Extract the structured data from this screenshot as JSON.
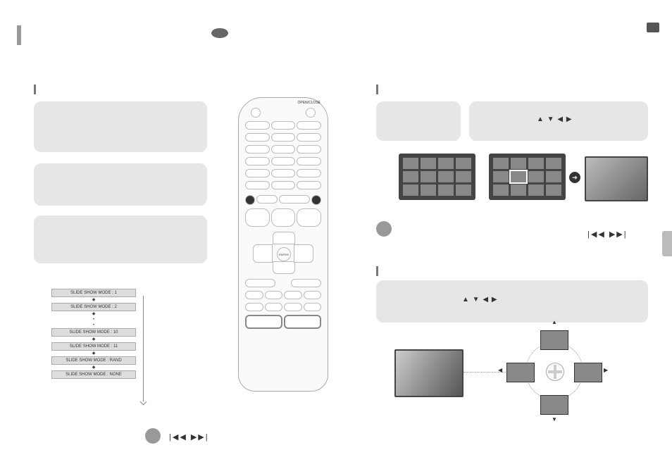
{
  "head": {
    "marker": "",
    "page_num": ""
  },
  "left": {
    "section_heading": "",
    "mode_labels": [
      "SLIDE SHOW MODE : 1",
      "SLIDE SHOW MODE : 2",
      "SLIDE SHOW MODE : 10",
      "SLIDE SHOW MODE : 11",
      "SLIDE SHOW MODE : RAND",
      "SLIDE SHOW MODE : NONE"
    ],
    "remote_enter": "ENTER",
    "remote_top_label": "OPEN/CLOSE",
    "skip_icons": "|◀◀  ▶▶|"
  },
  "right": {
    "nav_icons": "▲  ▼  ◀  ▶",
    "skip_icons": "|◀◀  ▶▶|",
    "rotate_nav": "▲  ▼  ◀  ▶"
  }
}
